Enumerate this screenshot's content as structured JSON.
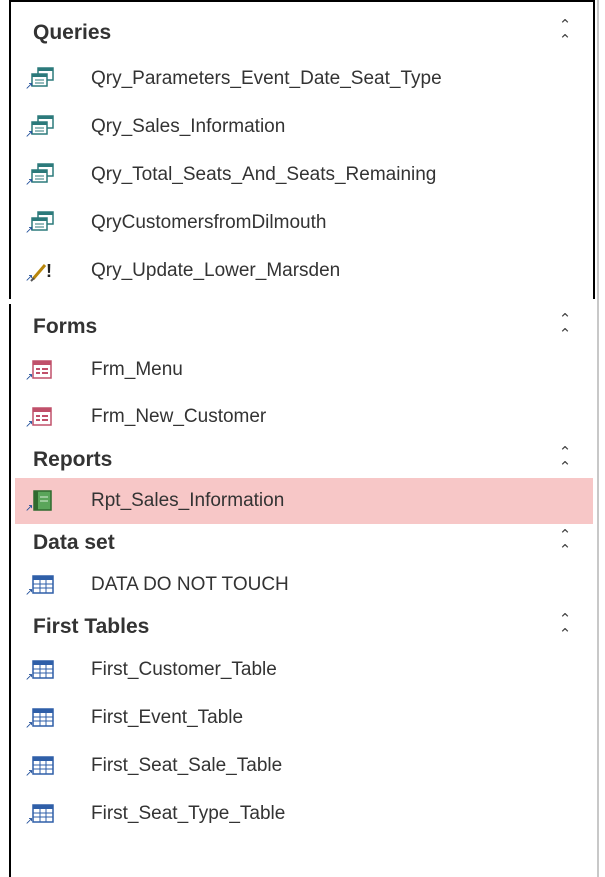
{
  "colors": {
    "selected_background": "#f7c7c7",
    "query_icon": "#2c7a7b",
    "form_icon": "#c0506a",
    "report_icon": "#3c8a3c",
    "table_icon": "#2f5fa8"
  },
  "groups": [
    {
      "title": "Queries",
      "collapse_icon": "double-chevron-up-icon",
      "items": [
        {
          "label": "Qry_Parameters_Event_Date_Seat_Type",
          "icon": "query-icon"
        },
        {
          "label": "Qry_Sales_Information",
          "icon": "query-icon"
        },
        {
          "label": "Qry_Total_Seats_And_Seats_Remaining",
          "icon": "query-icon"
        },
        {
          "label": "QryCustomersfromDilmouth",
          "icon": "query-icon"
        },
        {
          "label": "Qry_Update_Lower_Marsden",
          "icon": "update-query-icon"
        }
      ]
    },
    {
      "title": "Forms",
      "collapse_icon": "double-chevron-up-icon",
      "items": [
        {
          "label": "Frm_Menu",
          "icon": "form-icon"
        },
        {
          "label": "Frm_New_Customer",
          "icon": "form-icon"
        }
      ]
    },
    {
      "title": "Reports",
      "collapse_icon": "double-chevron-up-icon",
      "items": [
        {
          "label": "Rpt_Sales_Information",
          "icon": "report-icon",
          "selected": true
        }
      ]
    },
    {
      "title": "Data set",
      "collapse_icon": "double-chevron-up-icon",
      "items": [
        {
          "label": "DATA DO NOT TOUCH",
          "icon": "table-icon"
        }
      ]
    },
    {
      "title": "First Tables",
      "collapse_icon": "double-chevron-up-icon",
      "items": [
        {
          "label": "First_Customer_Table",
          "icon": "table-icon"
        },
        {
          "label": "First_Event_Table",
          "icon": "table-icon"
        },
        {
          "label": "First_Seat_Sale_Table",
          "icon": "table-icon"
        },
        {
          "label": "First_Seat_Type_Table",
          "icon": "table-icon"
        }
      ]
    }
  ]
}
